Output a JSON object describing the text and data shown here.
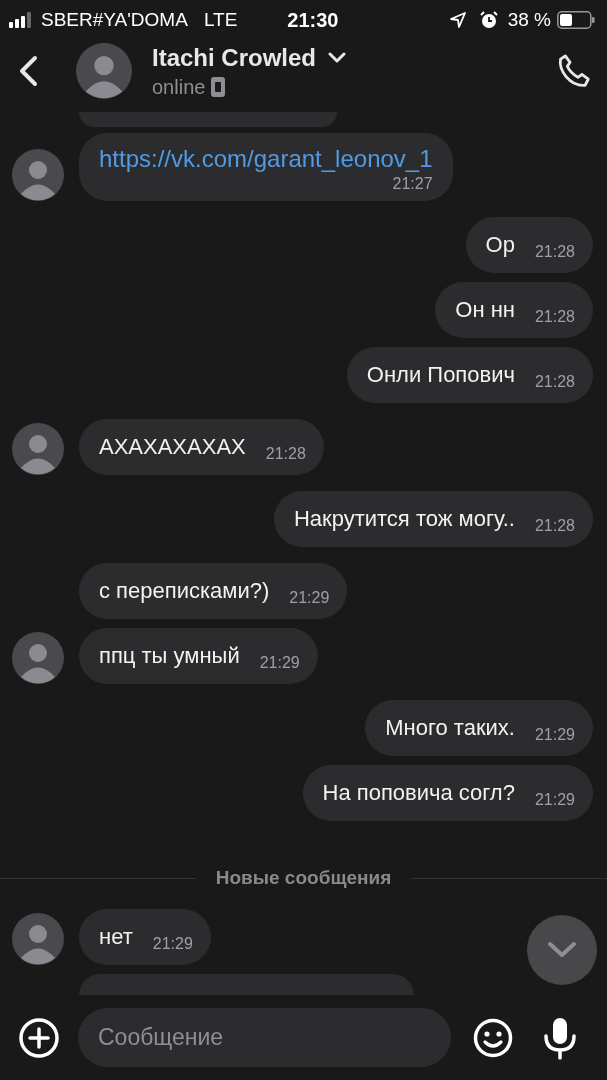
{
  "status_bar": {
    "carrier": "SBER#YA'DOMA",
    "network": "LTE",
    "time": "21:30",
    "battery": "38 %"
  },
  "header": {
    "name": "Itachi Crowled",
    "status": "online"
  },
  "messages": [
    {
      "kind": "cut_top"
    },
    {
      "kind": "link",
      "outgoing": false,
      "avatar": true,
      "text": "https://vk.com/garant_leonov_1",
      "time": "21:27"
    },
    {
      "kind": "text",
      "outgoing": true,
      "text": "Ор",
      "time": "21:28"
    },
    {
      "kind": "text",
      "outgoing": true,
      "text": "Он нн",
      "time": "21:28"
    },
    {
      "kind": "text",
      "outgoing": true,
      "text": "Онли Попович",
      "time": "21:28"
    },
    {
      "kind": "text",
      "outgoing": false,
      "avatar": true,
      "text": "АХАХАХАХАХ",
      "time": "21:28"
    },
    {
      "kind": "text",
      "outgoing": true,
      "text": "Накрутится тож могу..",
      "time": "21:28"
    },
    {
      "kind": "text",
      "outgoing": false,
      "avatar": false,
      "text": "с переписками?)",
      "time": "21:29"
    },
    {
      "kind": "text",
      "outgoing": false,
      "avatar": true,
      "text": "ппц ты умный",
      "time": "21:29"
    },
    {
      "kind": "text",
      "outgoing": true,
      "text": "Много таких.",
      "time": "21:29"
    },
    {
      "kind": "text",
      "outgoing": true,
      "text": "На поповича согл?",
      "time": "21:29"
    },
    {
      "kind": "divider",
      "text": "Новые сообщения"
    },
    {
      "kind": "text",
      "outgoing": false,
      "avatar": true,
      "text": "нет",
      "time": "21:29"
    },
    {
      "kind": "cut_bottom"
    }
  ],
  "composer": {
    "placeholder": "Сообщение"
  }
}
